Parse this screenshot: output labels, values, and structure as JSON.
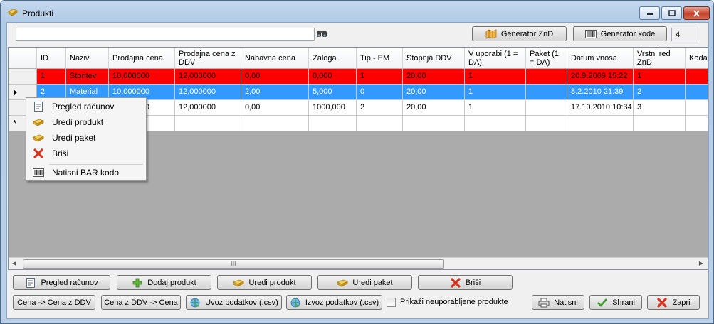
{
  "window": {
    "title": "Produkti",
    "colors": {
      "selected_row": "#3399ff",
      "highlight_row": "#ff0000"
    }
  },
  "toolbar": {
    "search_value": "",
    "generator_znd_label": "Generator ZnD",
    "generator_kode_label": "Generator kode",
    "counter": "4"
  },
  "grid": {
    "columns": [
      "ID",
      "Naziv",
      "Prodajna cena",
      "Prodajna cena z DDV",
      "Nabavna cena",
      "Zaloga",
      "Tip - EM",
      "Stopnja DDV",
      "V uporabi (1 = DA)",
      "Paket (1 = DA)",
      "Datum vnosa",
      "Vrstni red ZnD",
      "Koda"
    ],
    "rows": [
      [
        "1",
        "Storitev",
        "10,000000",
        "12,000000",
        "0,00",
        "0,000",
        "1",
        "20,00",
        "1",
        "",
        "20.9.2009 15:22",
        "1",
        ""
      ],
      [
        "2",
        "Material",
        "10,000000",
        "12,000000",
        "2,00",
        "5,000",
        "0",
        "20,00",
        "1",
        "",
        "8.2.2010 21:39",
        "2",
        ""
      ],
      [
        "3",
        "",
        "10,000000",
        "12,000000",
        "0,00",
        "1000,000",
        "2",
        "20,00",
        "1",
        "",
        "17.10.2010 10:34",
        "3",
        ""
      ]
    ],
    "new_row_marker": "*",
    "scroll_thumb_label": "III"
  },
  "context_menu": {
    "items": [
      {
        "label": "Pregled računov",
        "icon": "receipt-icon"
      },
      {
        "label": "Uredi produkt",
        "icon": "edit-product-icon"
      },
      {
        "label": "Uredi paket",
        "icon": "edit-package-icon"
      },
      {
        "label": "Briši",
        "icon": "delete-icon"
      },
      {
        "label": "Natisni BAR kodo",
        "icon": "barcode-icon"
      }
    ]
  },
  "buttons_row1": {
    "pregled_racunov": "Pregled računov",
    "dodaj_produkt": "Dodaj produkt",
    "uredi_produkt": "Uredi produkt",
    "uredi_paket": "Uredi paket",
    "brisi": "Briši"
  },
  "buttons_row2": {
    "cena_to_ddv": "Cena -> Cena z DDV",
    "ddv_to_cena": "Cena z DDV -> Cena",
    "uvoz": "Uvoz podatkov (.csv)",
    "izvoz": "Izvoz podatkov (.csv)",
    "show_unused_label": "Prikaži neuporabljene produkte",
    "natisni": "Natisni",
    "shrani": "Shrani",
    "zapri": "Zapri"
  }
}
